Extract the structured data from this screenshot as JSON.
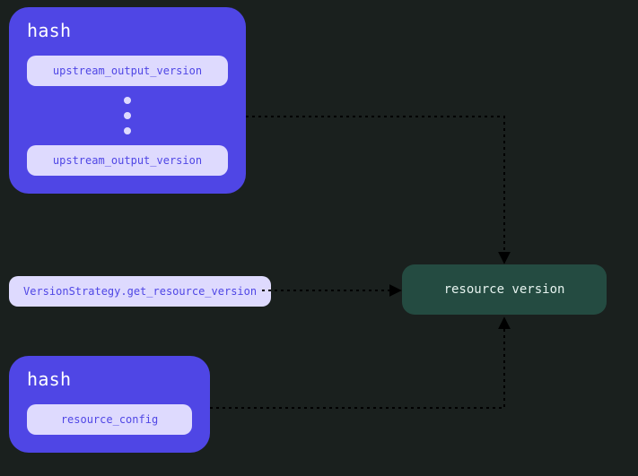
{
  "hashTop": {
    "title": "hash",
    "item1": "upstream_output_version",
    "item2": "upstream_output_version"
  },
  "middle": {
    "label": "VersionStrategy.get_resource_version"
  },
  "hashBottom": {
    "title": "hash",
    "item": "resource_config"
  },
  "result": {
    "label": "resource version"
  },
  "colors": {
    "group": "#4f46e5",
    "pill": "#dedafe",
    "result": "#244b41",
    "bg": "#1a201e"
  }
}
